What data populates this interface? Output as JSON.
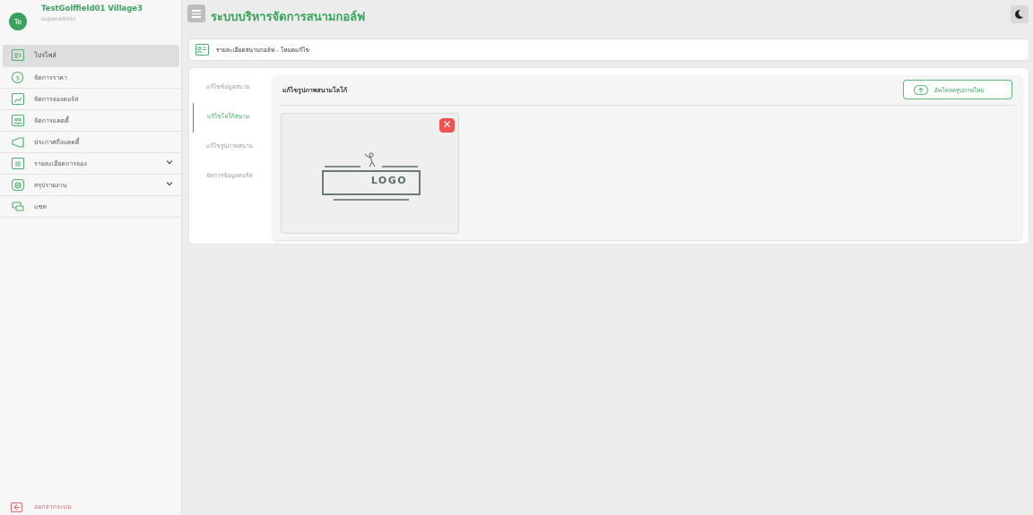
{
  "profile": {
    "initials": "Te",
    "name": "TestGolffield01 Village3",
    "role": "superadmin"
  },
  "sidebar": {
    "items": [
      {
        "label": "โปรไฟล์",
        "icon": "profile-card-icon",
        "active": true
      },
      {
        "label": "จัดการราคา",
        "icon": "dollar-icon"
      },
      {
        "label": "จัดการจองคอร์ส",
        "icon": "trend-chart-icon"
      },
      {
        "label": "จัดการแคดดี้",
        "icon": "users-icon"
      },
      {
        "label": "ประกาศถึงแคดดี้",
        "icon": "megaphone-icon"
      },
      {
        "label": "รายละเอียดการจอง",
        "icon": "list-icon",
        "expandable": true
      },
      {
        "label": "สรุปรายงาน",
        "icon": "database-icon",
        "expandable": true
      },
      {
        "label": "แชท",
        "icon": "chat-icon"
      }
    ],
    "logout_label": "ออกจากระบบ"
  },
  "header": {
    "title": "ระบบบริหารจัดการสนามกอล์ฟ"
  },
  "breadcrumb": {
    "text": "รายละเอียดสนามกอล์ฟ - โหมดแก้ไข"
  },
  "subnav": {
    "items": [
      {
        "label": "แก้ไขข้อมูลสนาม"
      },
      {
        "label": "แก้ไขโลโก้สนาม",
        "active": true
      },
      {
        "label": "แก้ไขรูปภาพสนาม"
      },
      {
        "label": "จัดการข้อมูลคอร์ส"
      }
    ]
  },
  "panel": {
    "title": "แก้ไขรูปภาพสนามโลโก้",
    "upload_label": "อัพโหลดรูปภาพใหม่",
    "logo_text": "LOGO",
    "delete_symbol": "✕"
  },
  "colors": {
    "accent": "#3aa35b",
    "danger": "#ee5252",
    "background": "#ececec"
  }
}
